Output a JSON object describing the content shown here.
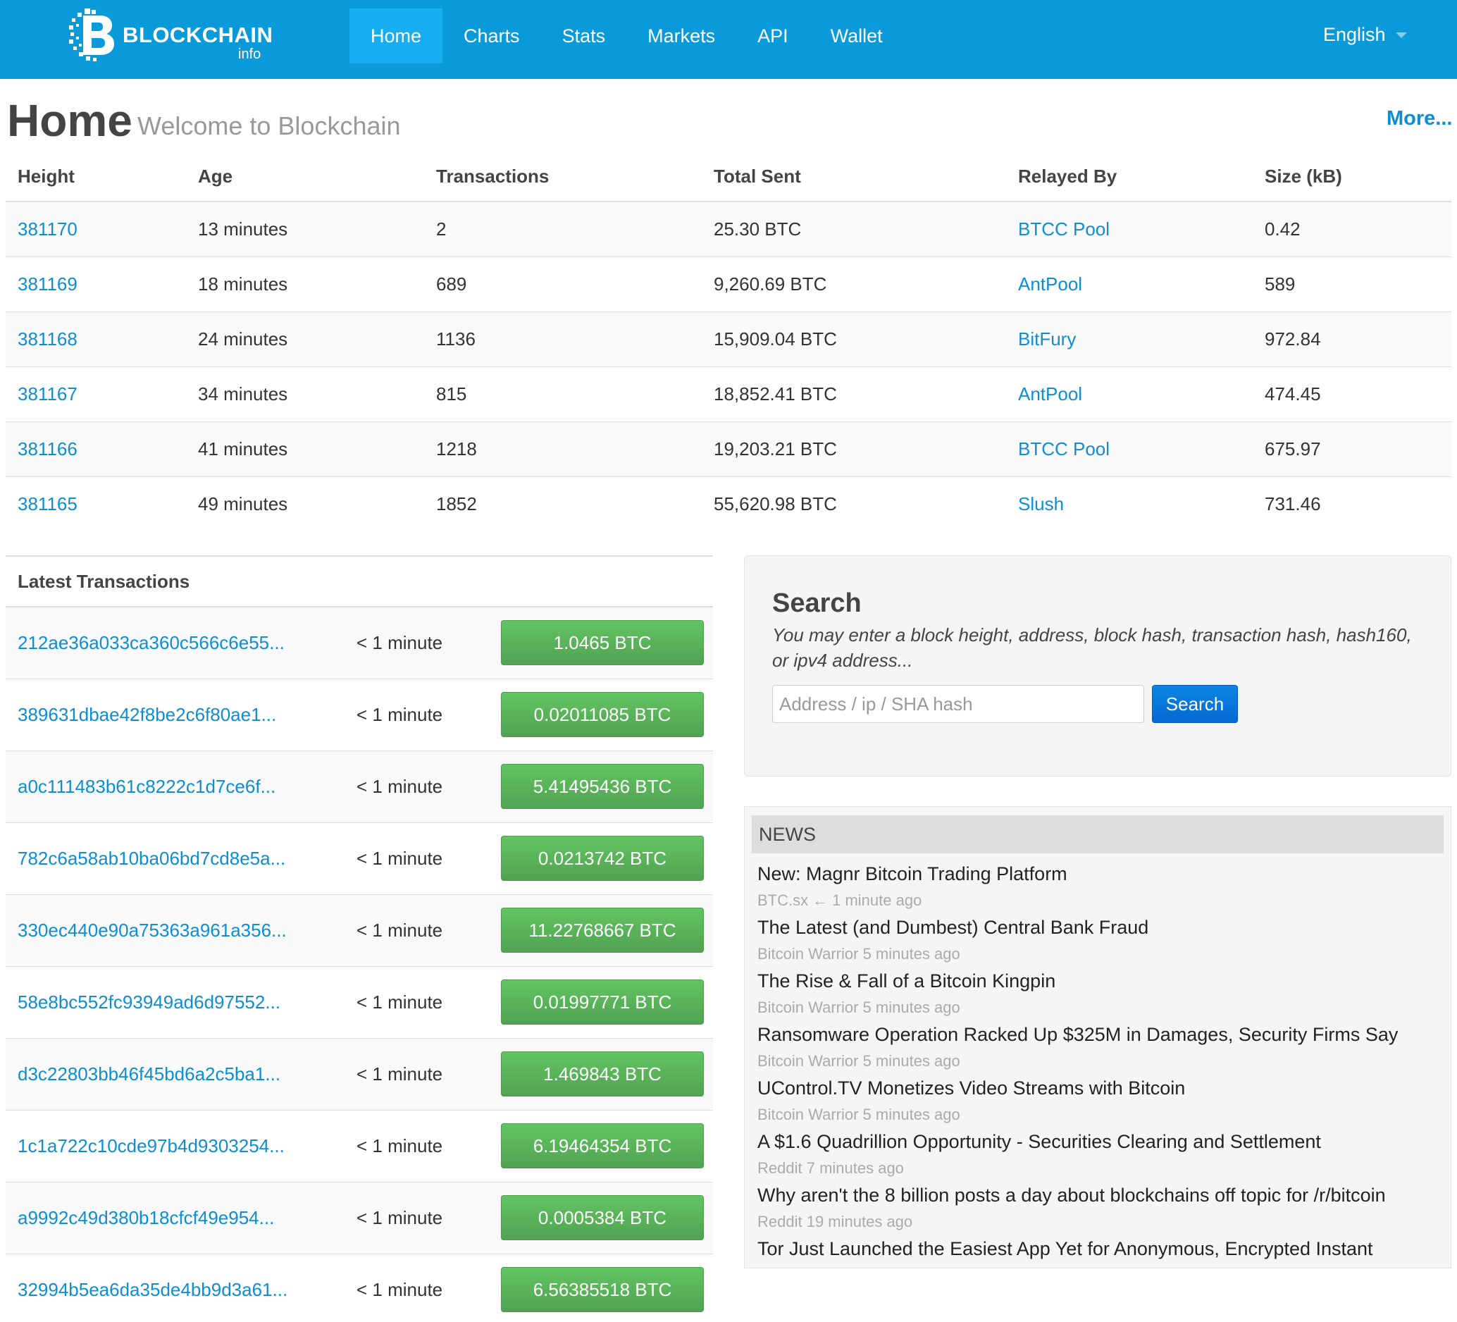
{
  "navbar": {
    "brand_name": "BLOCKCHAIN",
    "brand_sub": "info",
    "items": [
      {
        "label": "Home",
        "active": true
      },
      {
        "label": "Charts",
        "active": false
      },
      {
        "label": "Stats",
        "active": false
      },
      {
        "label": "Markets",
        "active": false
      },
      {
        "label": "API",
        "active": false
      },
      {
        "label": "Wallet",
        "active": false
      }
    ],
    "language": "English"
  },
  "header": {
    "title": "Home",
    "subtitle": "Welcome to Blockchain",
    "more": "More..."
  },
  "blocks": {
    "columns": [
      "Height",
      "Age",
      "Transactions",
      "Total Sent",
      "Relayed By",
      "Size (kB)"
    ],
    "rows": [
      {
        "height": "381170",
        "age": "13 minutes",
        "transactions": "2",
        "total_sent": "25.30 BTC",
        "relayed_by": "BTCC Pool",
        "size": "0.42"
      },
      {
        "height": "381169",
        "age": "18 minutes",
        "transactions": "689",
        "total_sent": "9,260.69 BTC",
        "relayed_by": "AntPool",
        "size": "589"
      },
      {
        "height": "381168",
        "age": "24 minutes",
        "transactions": "1136",
        "total_sent": "15,909.04 BTC",
        "relayed_by": "BitFury",
        "size": "972.84"
      },
      {
        "height": "381167",
        "age": "34 minutes",
        "transactions": "815",
        "total_sent": "18,852.41 BTC",
        "relayed_by": "AntPool",
        "size": "474.45"
      },
      {
        "height": "381166",
        "age": "41 minutes",
        "transactions": "1218",
        "total_sent": "19,203.21 BTC",
        "relayed_by": "BTCC Pool",
        "size": "675.97"
      },
      {
        "height": "381165",
        "age": "49 minutes",
        "transactions": "1852",
        "total_sent": "55,620.98 BTC",
        "relayed_by": "Slush",
        "size": "731.46"
      }
    ]
  },
  "transactions": {
    "title": "Latest Transactions",
    "rows": [
      {
        "hash": "212ae36a033ca360c566c6e55...",
        "age": "< 1 minute",
        "amount": "1.0465 BTC"
      },
      {
        "hash": "389631dbae42f8be2c6f80ae1...",
        "age": "< 1 minute",
        "amount": "0.02011085 BTC"
      },
      {
        "hash": "a0c111483b61c8222c1d7ce6f...",
        "age": "< 1 minute",
        "amount": "5.41495436 BTC"
      },
      {
        "hash": "782c6a58ab10ba06bd7cd8e5a...",
        "age": "< 1 minute",
        "amount": "0.0213742 BTC"
      },
      {
        "hash": "330ec440e90a75363a961a356...",
        "age": "< 1 minute",
        "amount": "11.22768667 BTC"
      },
      {
        "hash": "58e8bc552fc93949ad6d97552...",
        "age": "< 1 minute",
        "amount": "0.01997771 BTC"
      },
      {
        "hash": "d3c22803bb46f45bd6a2c5ba1...",
        "age": "< 1 minute",
        "amount": "1.469843 BTC"
      },
      {
        "hash": "1c1a722c10cde97b4d9303254...",
        "age": "< 1 minute",
        "amount": "6.19464354 BTC"
      },
      {
        "hash": "a9992c49d380b18cfcf49e954...",
        "age": "< 1 minute",
        "amount": "0.0005384 BTC"
      },
      {
        "hash": "32994b5ea6da35de4bb9d3a61...",
        "age": "< 1 minute",
        "amount": "6.56385518 BTC"
      }
    ]
  },
  "search": {
    "title": "Search",
    "help": "You may enter a block height, address, block hash, transaction hash, hash160, or ipv4 address...",
    "placeholder": "Address / ip / SHA hash",
    "value": "",
    "button": "Search"
  },
  "news": {
    "title": "NEWS",
    "items": [
      {
        "title": "New: Magnr Bitcoin Trading Platform",
        "source": "BTC.sx",
        "arrow": true,
        "time": "1 minute ago"
      },
      {
        "title": "The Latest (and Dumbest) Central Bank Fraud",
        "source": "Bitcoin Warrior",
        "arrow": false,
        "time": "5 minutes ago"
      },
      {
        "title": "The Rise & Fall of a Bitcoin Kingpin",
        "source": "Bitcoin Warrior",
        "arrow": false,
        "time": "5 minutes ago"
      },
      {
        "title": "Ransomware Operation Racked Up $325M in Damages, Security Firms Say",
        "source": "Bitcoin Warrior",
        "arrow": false,
        "time": "5 minutes ago"
      },
      {
        "title": "UControl.TV Monetizes Video Streams with Bitcoin",
        "source": "Bitcoin Warrior",
        "arrow": false,
        "time": "5 minutes ago"
      },
      {
        "title": "A $1.6 Quadrillion Opportunity - Securities Clearing and Settlement",
        "source": "Reddit",
        "arrow": false,
        "time": "7 minutes ago"
      },
      {
        "title": "Why aren't the 8 billion posts a day about blockchains off topic for /r/bitcoin",
        "source": "Reddit",
        "arrow": false,
        "time": "19 minutes ago"
      },
      {
        "title": "Tor Just Launched the Easiest App Yet for Anonymous, Encrypted Instant",
        "source": "",
        "arrow": false,
        "time": ""
      }
    ]
  },
  "colors": {
    "navbar": "#0a9ad9",
    "nav_active": "#16aef0",
    "link": "#0d8ed4",
    "success": "#5bb75b",
    "primary_button": "#0569d2"
  }
}
